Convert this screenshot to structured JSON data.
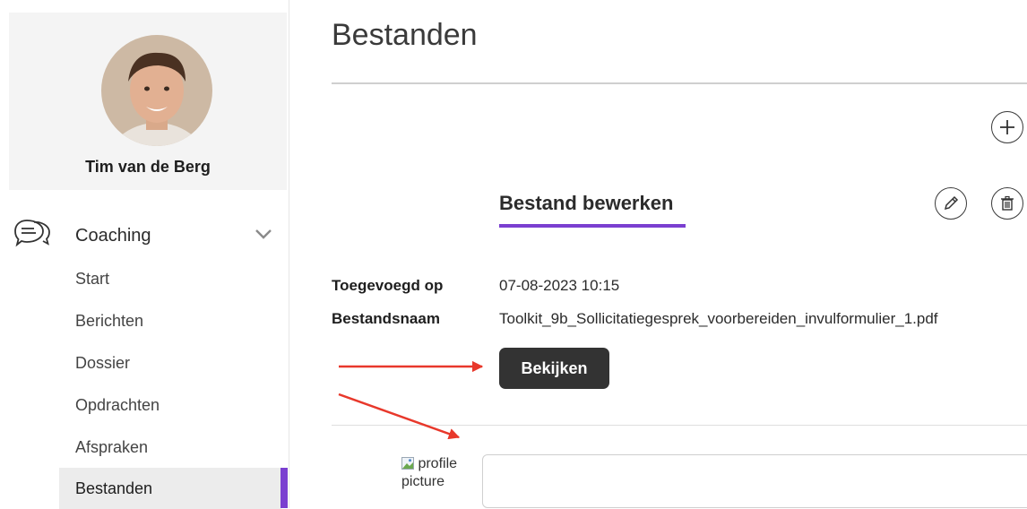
{
  "sidebar": {
    "user_name": "Tim van de Berg",
    "section_label": "Coaching",
    "items": [
      {
        "label": "Start"
      },
      {
        "label": "Berichten"
      },
      {
        "label": "Dossier"
      },
      {
        "label": "Opdrachten"
      },
      {
        "label": "Afspraken"
      },
      {
        "label": "Bestanden"
      }
    ],
    "active_item": "Bestanden"
  },
  "main": {
    "page_title": "Bestanden",
    "section_heading": "Bestand bewerken",
    "fields": [
      {
        "label": "Toegevoegd op",
        "value": "07-08-2023 10:15"
      },
      {
        "label": "Bestandsnaam",
        "value": "Toolkit_9b_Sollicitatiegesprek_voorbereiden_invulformulier_1.pdf"
      }
    ],
    "view_button_label": "Bekijken",
    "profile_picture_alt": "profile picture",
    "comment_value": ""
  },
  "icons": [
    "chat-bubbles-icon",
    "chevron-down-icon",
    "plus-icon",
    "pencil-icon",
    "trash-icon"
  ],
  "colors": {
    "accent": "#7a3fd0",
    "button_dark": "#333333",
    "annotation_arrow": "#e8382b",
    "profile_card_bg": "#f4f4f4"
  }
}
